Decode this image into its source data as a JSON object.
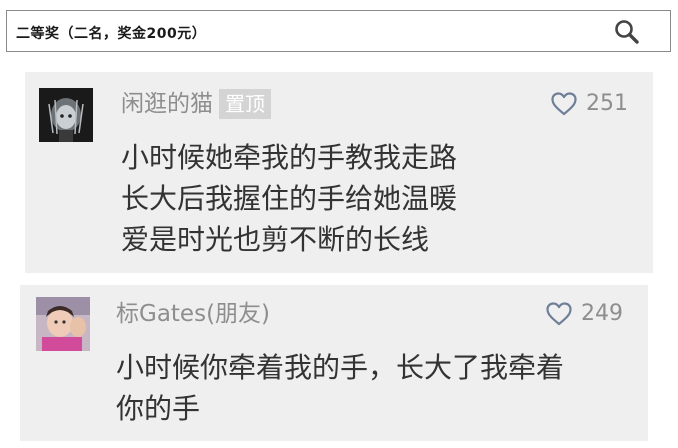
{
  "search": {
    "text": "二等奖（二名，奖金200元）",
    "icon": "search-icon"
  },
  "comments": [
    {
      "username": "闲逛的猫",
      "badge": "置顶",
      "likes": "251",
      "lines": [
        "小时候她牵我的手教我走路",
        "长大后我握住的手给她温暖",
        "爱是时光也剪不断的长线"
      ]
    },
    {
      "username": "标Gates(朋友)",
      "likes": "249",
      "lines": [
        "小时候你牵着我的手，长大了我牵着",
        "你的手"
      ]
    }
  ],
  "colors": {
    "card_bg": "#efefef",
    "meta_text": "#8e8e8e",
    "body_text": "#333333",
    "badge_bg": "#d4d4d4",
    "heart": "#6f7f99"
  }
}
